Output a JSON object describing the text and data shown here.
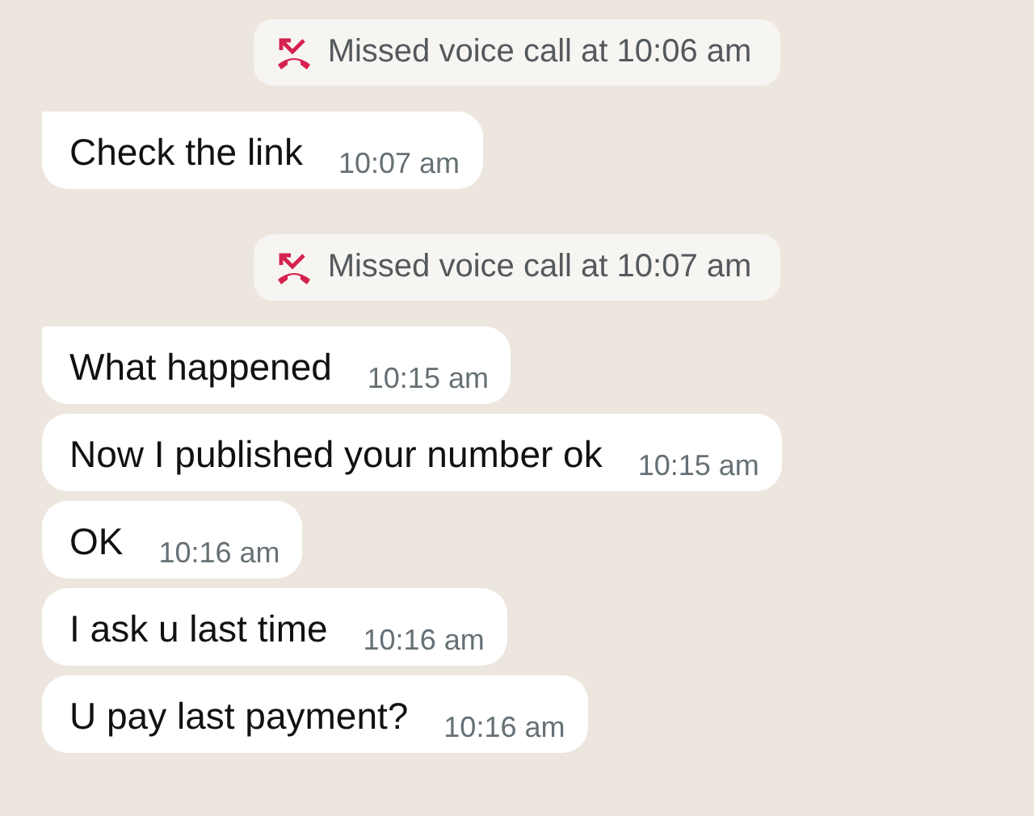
{
  "messages": [
    {
      "kind": "system",
      "text": "Missed voice call at 10:06 am"
    },
    {
      "kind": "message",
      "text": "Check the link",
      "time": "10:07 am",
      "first": true
    },
    {
      "kind": "system",
      "text": "Missed voice call at 10:07 am"
    },
    {
      "kind": "message",
      "text": "What happened",
      "time": "10:15 am",
      "first": true
    },
    {
      "kind": "message",
      "text": "Now I published your number ok",
      "time": "10:15 am",
      "first": false
    },
    {
      "kind": "message",
      "text": "OK",
      "time": "10:16 am",
      "first": false
    },
    {
      "kind": "message",
      "text": "I ask u last time",
      "time": "10:16 am",
      "first": false
    },
    {
      "kind": "message",
      "text": "U pay last payment?",
      "time": "10:16 am",
      "first": false
    }
  ]
}
